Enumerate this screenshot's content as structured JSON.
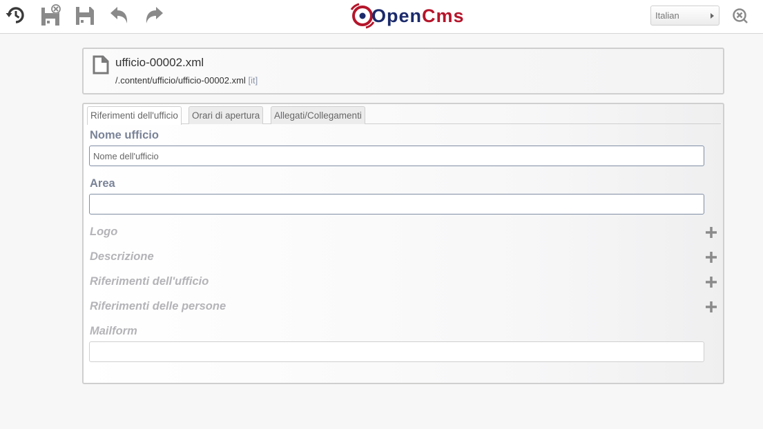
{
  "toolbar": {
    "buttons": [
      {
        "name": "history-icon"
      },
      {
        "name": "save-exit-icon"
      },
      {
        "name": "save-icon"
      },
      {
        "name": "undo-icon"
      },
      {
        "name": "redo-icon"
      }
    ],
    "logo_text": "OpenCms",
    "language": "Italian",
    "close_icon": "close-icon"
  },
  "header": {
    "title": "ufficio-00002.xml",
    "path": "/.content/ufficio/ufficio-00002.xml",
    "locale": "[it]"
  },
  "tabs": [
    {
      "label": "Riferimenti dell'ufficio",
      "active": true
    },
    {
      "label": "Orari di apertura",
      "active": false
    },
    {
      "label": "Allegati/Collegamenti",
      "active": false
    }
  ],
  "fields": {
    "nome_ufficio": {
      "label": "Nome ufficio",
      "value": "Nome dell'ufficio"
    },
    "area": {
      "label": "Area",
      "value": ""
    },
    "logo": {
      "label": "Logo"
    },
    "descrizione": {
      "label": "Descrizione"
    },
    "riferimenti_ufficio": {
      "label": "Riferimenti dell'ufficio"
    },
    "riferimenti_persone": {
      "label": "Riferimenti delle persone"
    },
    "mailform": {
      "label": "Mailform",
      "value": ""
    }
  },
  "colors": {
    "logo_red": "#b5152b",
    "logo_blue": "#1b2a6b",
    "label_blue": "#7a8397",
    "label_optional": "#b4b4b8"
  }
}
